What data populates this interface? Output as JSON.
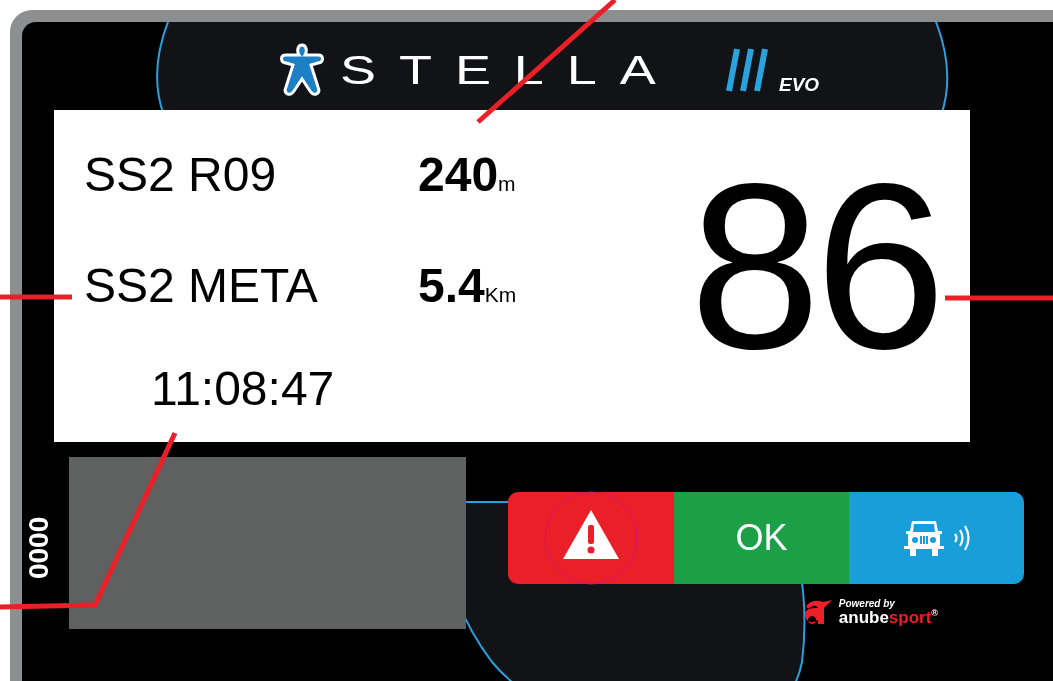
{
  "brand": {
    "name": "STELLA",
    "edition": "EVO"
  },
  "panel": {
    "rows": [
      {
        "label": "SS2 R09",
        "value": "240",
        "unit": "m"
      },
      {
        "label": "SS2 META",
        "value": "5.4",
        "unit": "Km"
      }
    ],
    "clock": "11:08:47",
    "big_number": "86"
  },
  "side_counter": "0000",
  "buttons": [
    {
      "kind": "warning",
      "color": "#ea1f27"
    },
    {
      "kind": "ok",
      "label": "OK",
      "color": "#1ba048"
    },
    {
      "kind": "vehicle",
      "color": "#189ed8"
    }
  ],
  "footer": {
    "powered_by": "Powered by",
    "brand_main": "anube",
    "brand_accent": "sport",
    "registered": "®"
  }
}
